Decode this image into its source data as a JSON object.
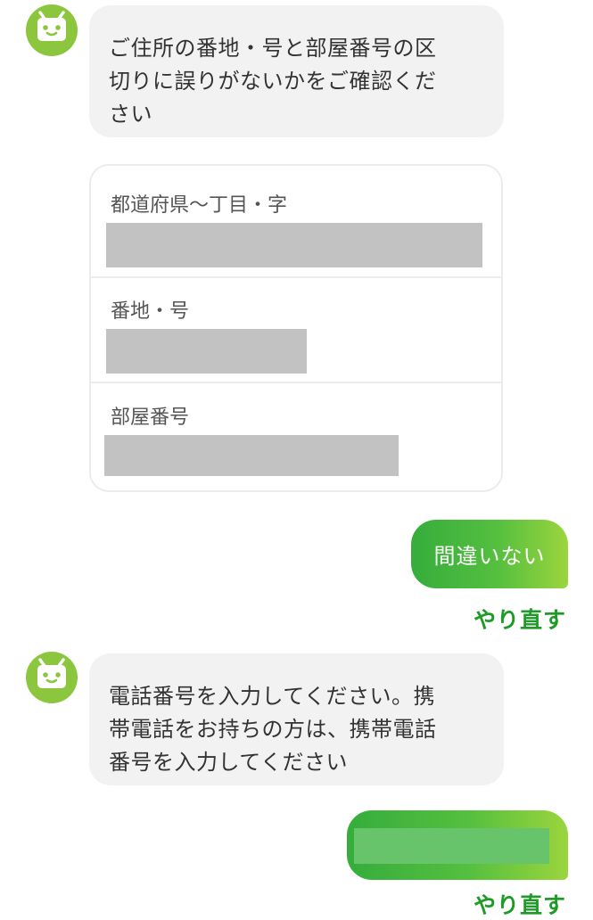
{
  "colors": {
    "bot_avatar": "#8cc63f",
    "bot_bubble": "#f2f2f2",
    "user_bubble_start": "#35ad3c",
    "user_bubble_end": "#9bd53d",
    "link_green": "#1e9a27",
    "redaction_gray": "#c2c2c2"
  },
  "icons": {
    "bot_avatar": "robot-face-icon"
  },
  "messages": {
    "bot_1": {
      "lines": [
        "ご住所の番地・号と部屋番号の区",
        "切りに誤りがないかをご確認くだ",
        "さい"
      ]
    },
    "address_card": {
      "field_1_label": "都道府県〜丁目・字",
      "field_2_label": "番地・号",
      "field_3_label": "部屋番号"
    },
    "user_reply_1": {
      "text": "間違いない",
      "redo_label": "やり直す"
    },
    "bot_2": {
      "lines": [
        "電話番号を入力してください。携",
        "帯電話をお持ちの方は、携帯電話",
        "番号を入力してください"
      ]
    },
    "user_reply_2": {
      "redo_label": "やり直す"
    }
  }
}
